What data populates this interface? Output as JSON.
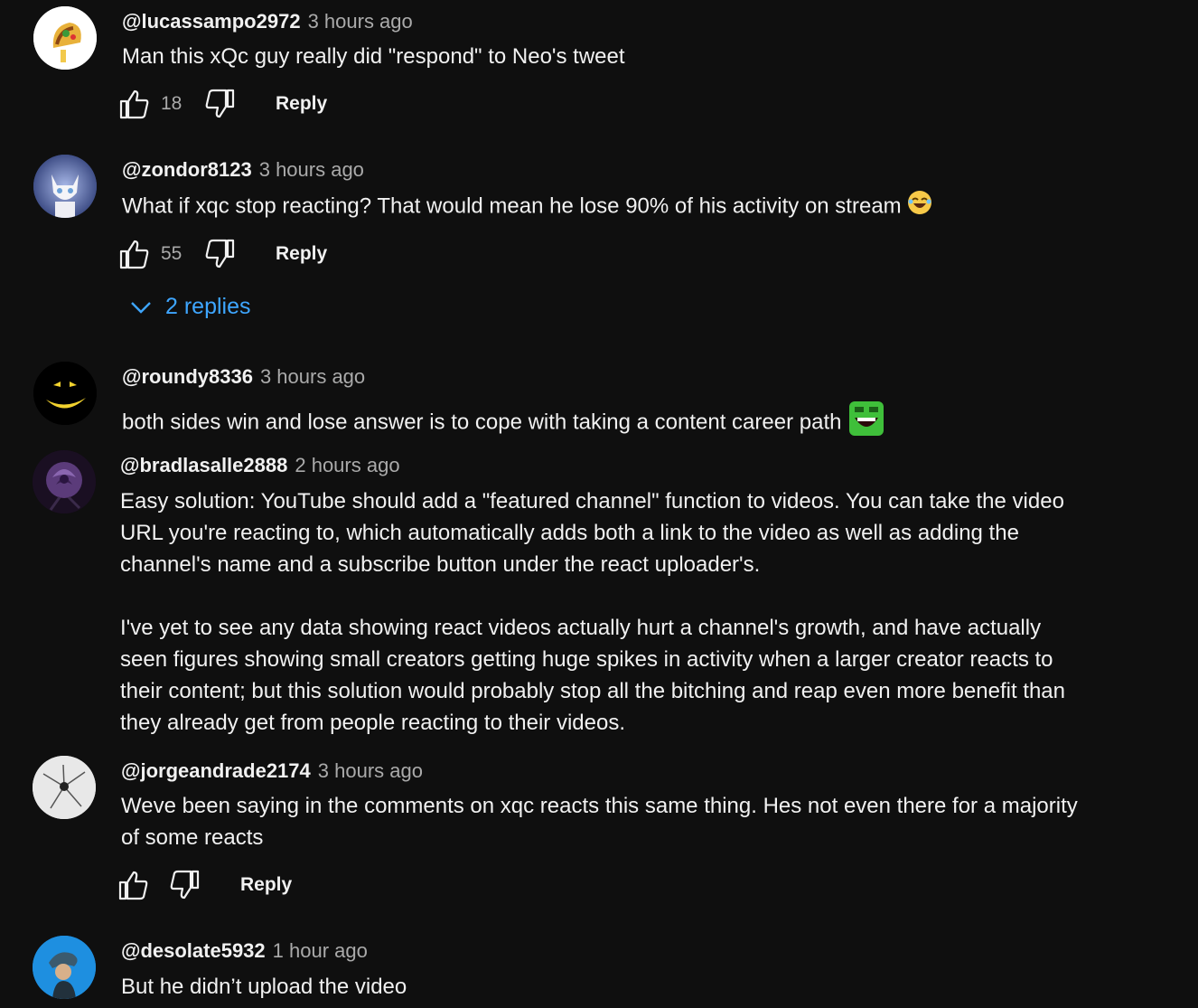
{
  "comments": [
    {
      "handle": "@lucassampo2972",
      "time": "3 hours ago",
      "text": "Man this xQc guy really did \"respond\" to Neo's tweet",
      "likes": "18",
      "reply_label": "Reply"
    },
    {
      "handle": "@zondor8123",
      "time": "3 hours ago",
      "text": "What if xqc stop reacting? That would mean he lose 90% of his activity on stream",
      "likes": "55",
      "reply_label": "Reply",
      "replies_label": "2 replies"
    },
    {
      "handle": "@roundy8336",
      "time": "3 hours ago",
      "text": "both sides win and lose answer is to cope with taking a content career path"
    },
    {
      "handle": "@bradlasalle2888",
      "time": "2 hours ago",
      "text": "Easy solution: YouTube should add a \"featured channel\" function to videos. You can take the video\nURL you're reacting to, which automatically adds both a link to the video as well as adding the\nchannel's name and a subscribe button under the react uploader's.\n\nI've yet to see any data showing react videos actually hurt a channel's growth, and have actually\nseen figures showing small creators getting huge spikes in activity when a larger creator reacts to\ntheir content; but this solution would probably stop all the bitching and reap even more benefit than\nthey already get from people reacting to their videos."
    },
    {
      "handle": "@jorgeandrade2174",
      "time": "3 hours ago",
      "text": "Weve been saying in the comments on xqc reacts this same thing. Hes not even there for a majority\nof some reacts",
      "reply_label": "Reply"
    },
    {
      "handle": "@desolate5932",
      "time": "1 hour ago",
      "text": "But he didn’t upload the video"
    }
  ],
  "colors": {
    "background": "#0f0f0f",
    "text": "#f1f1f1",
    "secondary": "#aaaaaa",
    "link_blue": "#3ea6ff"
  }
}
